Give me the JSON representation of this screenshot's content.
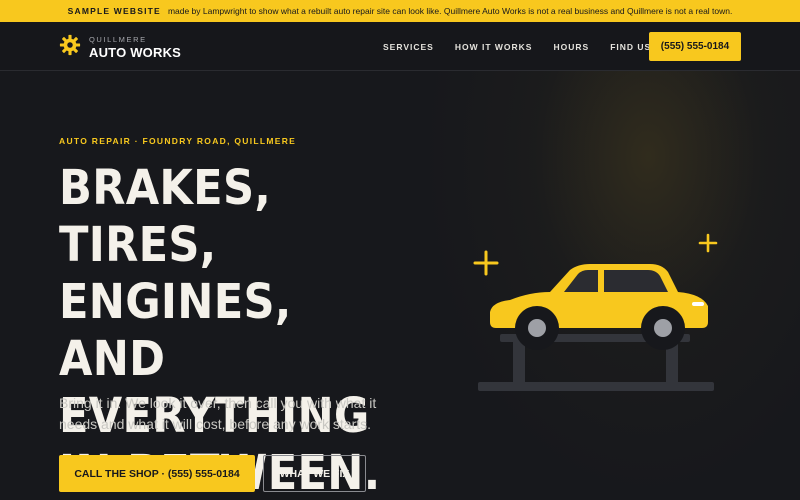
{
  "banner": {
    "tag": "SAMPLE WEBSITE",
    "text": "made by Lampwright to show what a rebuilt auto repair site can look like. Quillmere Auto Works is not a real business and Quillmere is not a real town."
  },
  "brand": {
    "small": "QUILLMERE",
    "name": "AUTO WORKS",
    "icon": "gear-icon"
  },
  "nav": {
    "links": [
      "SERVICES",
      "HOW IT WORKS",
      "HOURS",
      "FIND US"
    ],
    "cta": "(555) 555-0184"
  },
  "hero": {
    "eyebrow": "AUTO REPAIR · FOUNDRY ROAD, QUILLMERE",
    "headline": "BRAKES, TIRES, ENGINES, AND EVERYTHING IN BETWEEN.",
    "sub": "Bring it in. We look it over, then call you with what it needs and what it will cost, before any work starts.",
    "primary_button": "CALL THE SHOP · (555) 555-0184",
    "secondary_button": "WHAT WE FIX"
  },
  "illustration": {
    "icon": "car-on-lift-icon",
    "sparkle_icon": "sparkle-plus-icon"
  },
  "colors": {
    "accent": "#f8c81e",
    "background": "#17181c",
    "text": "#f4f1ea"
  }
}
